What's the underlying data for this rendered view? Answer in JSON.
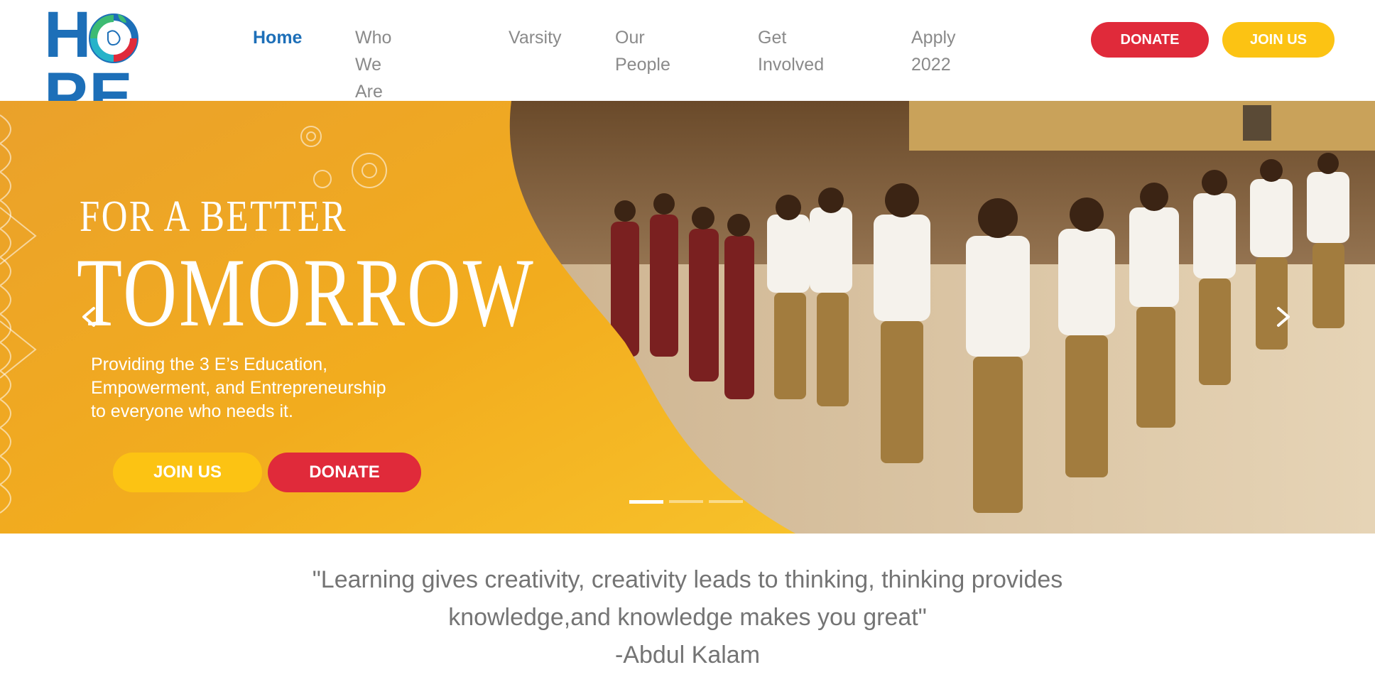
{
  "brand": {
    "logo_text": "HOPE",
    "logo_letters": [
      "H",
      "PE"
    ],
    "primary_color": "#1d6fb8"
  },
  "nav": {
    "items": [
      {
        "label_lines": [
          "Home"
        ],
        "active": true
      },
      {
        "label_lines": [
          "Who We",
          "Are"
        ],
        "active": false
      },
      {
        "label_lines": [
          "Varsity"
        ],
        "active": false
      },
      {
        "label_lines": [
          "Our",
          "People"
        ],
        "active": false
      },
      {
        "label_lines": [
          "Get",
          "Involved"
        ],
        "active": false
      },
      {
        "label_lines": [
          "Apply",
          "2022"
        ],
        "active": false
      }
    ]
  },
  "header_buttons": {
    "donate": "DONATE",
    "join": "JOIN US"
  },
  "hero": {
    "heading_small": "FOR A BETTER",
    "heading_large": "TOMORROW",
    "subtitle_lines": [
      "Providing the 3 E’s Education,",
      "Empowerment, and Entrepreneurship",
      "to everyone who needs it."
    ],
    "join_button": "JOIN US",
    "donate_button": "DONATE",
    "slides": {
      "count": 3,
      "active_index": 0
    }
  },
  "quote": {
    "lines": [
      "\"Learning gives creativity, creativity leads to thinking, thinking provides",
      "knowledge,and knowledge makes you great\""
    ],
    "author": "-Abdul Kalam"
  },
  "colors": {
    "donate_red": "#e02a3a",
    "join_yellow": "#fcc313",
    "hero_orange": "#f0a319",
    "nav_text": "#8a8a8a",
    "quote_text": "#747474"
  },
  "icons": [
    "chevron-left-icon",
    "chevron-right-icon",
    "gear-icon",
    "mandala-border"
  ]
}
